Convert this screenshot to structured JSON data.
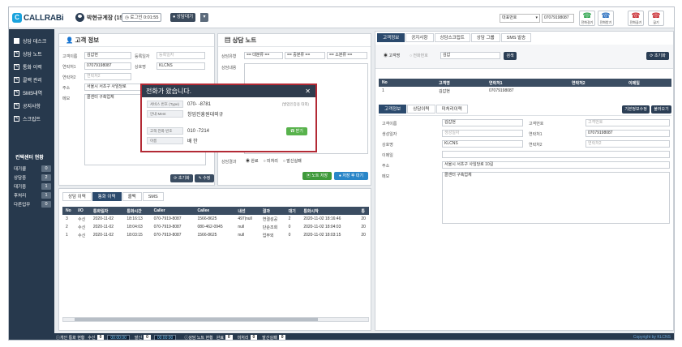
{
  "app": {
    "logo": "CALLRABi",
    "user_name": "박현규계장 (153)",
    "login_label": "로그인 0:01:55",
    "status": "상담대기"
  },
  "topbar": {
    "rep_select": "대표번호",
    "rep_number": "07079198087",
    "buttons": [
      {
        "label": "전화걸기",
        "glyph": "☎",
        "color": "#2aa24a"
      },
      {
        "label": "전화받기",
        "glyph": "☎",
        "color": "#2a6fbf"
      },
      {
        "label": "전화끊기",
        "glyph": "☎",
        "color": "#c8292f"
      },
      {
        "label": "끊기",
        "glyph": "☎",
        "color": "#c8292f"
      }
    ]
  },
  "sidebar": {
    "items": [
      {
        "label": "상담 데스크",
        "icon": "grid-icon"
      },
      {
        "label": "상담 노트",
        "icon": "edit-icon"
      },
      {
        "label": "통화 이력",
        "icon": "edit-icon"
      },
      {
        "label": "콜백 관리",
        "icon": "edit-icon"
      },
      {
        "label": "SMS내역",
        "icon": "edit-icon"
      },
      {
        "label": "공지사항",
        "icon": "edit-icon"
      },
      {
        "label": "스크립트",
        "icon": "edit-icon"
      }
    ],
    "center_title": "컨택센터 현황",
    "stats": [
      {
        "label": "대기콜",
        "value": "0"
      },
      {
        "label": "상담중",
        "value": "2"
      },
      {
        "label": "대기중",
        "value": "1"
      },
      {
        "label": "후처리",
        "value": "1"
      },
      {
        "label": "다른업무",
        "value": "0"
      }
    ]
  },
  "customer": {
    "title": "고객 정보",
    "fields": {
      "name_label": "고객이름",
      "name": "김갑현",
      "regdate_label": "등록일자",
      "regdate_ph": "등록일자",
      "phone1_label": "연락처1",
      "phone1": "07079198087",
      "company_label": "상호명",
      "company": "KLCNS",
      "phone2_label": "연락처2",
      "phone2_ph": "연락처2",
      "addr_label": "주소",
      "addr": "서울시 서초구 사임당로",
      "memo_label": "메모",
      "memo": "콜센터 구축업체"
    },
    "btn_reset": "초기화",
    "btn_edit": "수정"
  },
  "note": {
    "title": "상담 노트",
    "type_label": "상담유형",
    "sel_large": "== 대분류 ==",
    "sel_mid": "== 중분류 ==",
    "sel_small": "== 소분류 ==",
    "content_label": "상담내용",
    "result_label": "상담결과",
    "result_options": [
      "완료",
      "미처리",
      "발신실패"
    ],
    "btn_save": "노트 저장",
    "btn_save_end": "저장 후 대기"
  },
  "history": {
    "tabs": [
      "상담 이력",
      "통화 이력",
      "콜백",
      "SMS"
    ],
    "active_tab": 1,
    "columns": [
      "No",
      "I/O",
      "통화일자",
      "통화시간",
      "Caller",
      "Callee",
      "내선",
      "결과",
      "대기",
      "통화시작",
      "통"
    ],
    "rows": [
      [
        "3",
        "수신",
        "2020-11-02",
        "18:16:13",
        "070-7919-8087",
        "1566-8625",
        "497|null",
        "연결성공",
        "2",
        "2020-11-02 18:16:46",
        "20"
      ],
      [
        "2",
        "수신",
        "2020-11-02",
        "18:04:03",
        "070-7919-8087",
        "080-462-0945",
        "null",
        "단순조회",
        "0",
        "2020-11-02 18:04:03",
        "20"
      ],
      [
        "1",
        "수신",
        "2020-11-02",
        "18:03:15",
        "070-7919-8087",
        "1566-8625",
        "null",
        "업무외",
        "0",
        "2020-11-02 18:03:15",
        "20"
      ]
    ]
  },
  "right": {
    "tabs": [
      "고객정보",
      "공지사항",
      "상담스크립트",
      "상담 그룹",
      "SMS 발송"
    ],
    "active_tab": 0,
    "search_options": [
      "고객명",
      "전화번호"
    ],
    "search_value": "김갑",
    "btn_search": "검색",
    "btn_reset": "초기화",
    "result_columns": [
      "No",
      "고객명",
      "연락처1",
      "연락처2",
      "이메일"
    ],
    "result_rows": [
      [
        "1",
        "김갑현",
        "07079198087",
        "",
        ""
      ]
    ],
    "sub_tabs": [
      "고객정보",
      "상담이력",
      "미처리이력"
    ],
    "btn_basic_edit": "기본정보수정",
    "btn_load": "불러오기",
    "detail": {
      "name_label": "고객이름",
      "name": "김갑현",
      "no_label": "고객번호",
      "no_ph": "고객번호",
      "birth_label": "생성일자",
      "birth_ph": "생성일자",
      "phone1_label": "연락처1",
      "phone1": "07079198087",
      "company_label": "상호명",
      "company": "KLCNS",
      "phone2_label": "연락처2",
      "phone2_ph": "연락처2",
      "email_label": "이메일",
      "addr_label": "주소",
      "addr": "서울시 서초구 사임당로 10길",
      "memo_label": "메모",
      "memo": "콜센터 구축업체"
    }
  },
  "modal": {
    "title": "전화가 왔습니다.",
    "service_label": "서비스 번호 (Type)",
    "service_value": "070-      -8781",
    "service_hint": "(발업인증용 대외)",
    "guide_label": "안내 Ment",
    "guide_value": "창업진흥원대외규",
    "caller_label": "고객 전화 번호",
    "caller_value": "010      -7214",
    "name_label": "이름",
    "name_value": "배    한",
    "btn_answer": "받기"
  },
  "bottom": {
    "personal_label": "개인 통화 현황",
    "in_label": "수신",
    "in_count": "0",
    "in_time": "00:00:00",
    "out_label": "발신",
    "out_count": "0",
    "out_time": "00:00:00",
    "note_label": "상담 노트 현황",
    "done_label": "완료",
    "done": "0",
    "pending_label": "미처리",
    "pending": "0",
    "fail_label": "발신실패",
    "fail": "0",
    "copyright": "Copyright by KLCNS"
  }
}
